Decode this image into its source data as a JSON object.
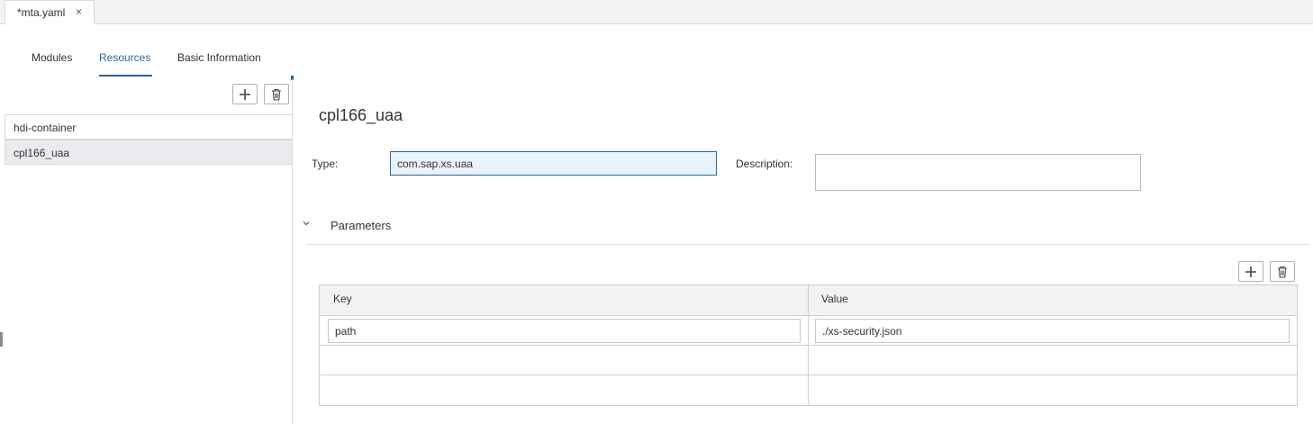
{
  "editor_tab": {
    "name": "*mta.yaml",
    "close_glyph": "×"
  },
  "sub_tabs": [
    {
      "label": "Modules"
    },
    {
      "label": "Resources",
      "active": true
    },
    {
      "label": "Basic Information"
    }
  ],
  "resources": {
    "items": [
      {
        "label": "hdi-container"
      },
      {
        "label": "cpl166_uaa",
        "selected": true
      }
    ]
  },
  "detail": {
    "title": "cpl166_uaa",
    "type_label": "Type:",
    "type_value": "com.sap.xs.uaa",
    "description_label": "Description:",
    "description_value": ""
  },
  "parameters": {
    "section_title": "Parameters",
    "columns": {
      "key": "Key",
      "value": "Value"
    },
    "rows": [
      {
        "key": "path",
        "value": "./xs-security.json"
      }
    ]
  },
  "icons": {
    "add": "plus-icon",
    "delete": "trash-icon",
    "collapse": "chevron-down-icon",
    "close": "close-icon"
  },
  "colors": {
    "accent": "#2a6496",
    "selected_row": "#e9ebee",
    "focused_input_bg": "#eaf3fb",
    "tabbar_bg": "#f2f2f2"
  }
}
